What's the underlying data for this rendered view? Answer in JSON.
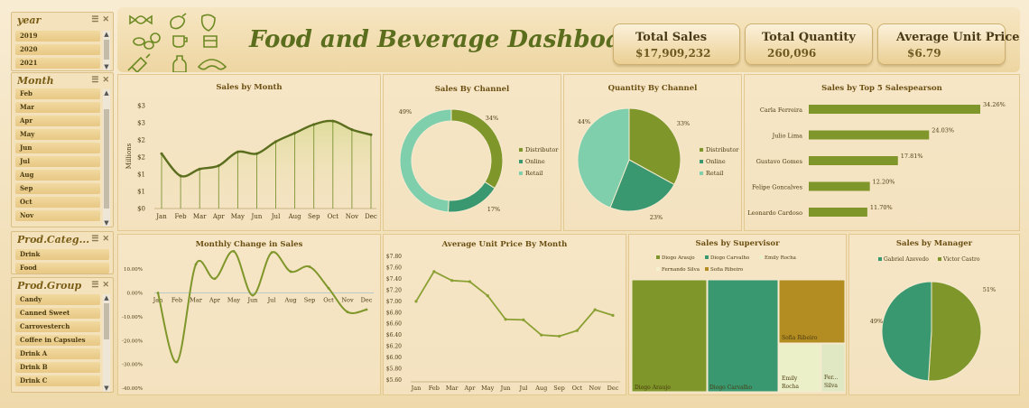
{
  "dashboard": {
    "title": "Food and Beverage Dashboard"
  },
  "kpis": {
    "total_sales": {
      "label": "Total Sales",
      "value": "$17,909,232"
    },
    "total_quantity": {
      "label": "Total Quantity",
      "value": "260,096"
    },
    "avg_unit_price": {
      "label": "Average Unit Price",
      "value": "$6.79"
    }
  },
  "slicers": {
    "year": {
      "label": "year",
      "items": [
        "2019",
        "2020",
        "2021"
      ]
    },
    "month": {
      "label": "Month",
      "items": [
        "Feb",
        "Mar",
        "Apr",
        "May",
        "Jun",
        "Jul",
        "Aug",
        "Sep",
        "Oct",
        "Nov"
      ]
    },
    "prod_category": {
      "label": "Prod.Categ...",
      "items": [
        "Drink",
        "Food"
      ]
    },
    "prod_group": {
      "label": "Prod.Group",
      "items": [
        "Candy",
        "Canned Sweet",
        "Carrovesterch",
        "Coffee in Capsules",
        "Drink A",
        "Drink B",
        "Drink C"
      ]
    }
  },
  "icons": [
    "wrapped-candy-icon",
    "eggplant-icon",
    "strawberry-icon",
    "coffee-beans-icon",
    "nut-icon",
    "coffee-cup-icon",
    "cake-icon",
    "candy-icon",
    "bottle-icon",
    "croissant-icon"
  ],
  "colors": {
    "olive": "#7f962a",
    "teal": "#3a9870",
    "mint": "#80cfac",
    "gold": "#b38d22",
    "cream": "#ecf0c8",
    "title": "#5b6e1e"
  },
  "chart_data": [
    {
      "type": "line",
      "title": "Sales by Month",
      "ylabel": "Millions",
      "categories": [
        "Jan",
        "Feb",
        "Mar",
        "Apr",
        "May",
        "Jun",
        "Jul",
        "Aug",
        "Sep",
        "Oct",
        "Nov",
        "Dec"
      ],
      "values": [
        1.6,
        0.95,
        1.15,
        1.25,
        1.65,
        1.6,
        1.95,
        2.2,
        2.45,
        2.55,
        2.3,
        2.15
      ],
      "yticks": [
        "$0",
        "$1",
        "$1",
        "$2",
        "$2",
        "$3",
        "$3"
      ],
      "ylim": [
        0,
        3
      ]
    },
    {
      "type": "pie",
      "title": "Sales By Channel",
      "series": [
        {
          "name": "Distributor",
          "value": 34,
          "label": "34%",
          "color": "#7f962a"
        },
        {
          "name": "Online",
          "value": 17,
          "label": "17%",
          "color": "#3a9870"
        },
        {
          "name": "Retail",
          "value": 49,
          "label": "49%",
          "color": "#80cfac"
        }
      ]
    },
    {
      "type": "pie",
      "title": "Quantity By Channel",
      "series": [
        {
          "name": "Distributor",
          "value": 33,
          "label": "33%",
          "color": "#7f962a"
        },
        {
          "name": "Online",
          "value": 23,
          "label": "23%",
          "color": "#3a9870"
        },
        {
          "name": "Retail",
          "value": 44,
          "label": "44%",
          "color": "#80cfac"
        }
      ]
    },
    {
      "type": "bar",
      "title": "Sales by Top 5 Salespearson",
      "categories": [
        "Carla Ferreira",
        "Julio Lima",
        "Gustavo Gomes",
        "Felipe Goncalves",
        "Leonardo Cardoso"
      ],
      "values": [
        34.26,
        24.03,
        17.81,
        12.2,
        11.7
      ],
      "labels": [
        "34.26%",
        "24.03%",
        "17.81%",
        "12.20%",
        "11.70%"
      ]
    },
    {
      "type": "line",
      "title": "Monthly Change in Sales",
      "categories": [
        "Jan",
        "Feb",
        "Mar",
        "Apr",
        "May",
        "Jun",
        "Jul",
        "Aug",
        "Sep",
        "Oct",
        "Nov",
        "Dec"
      ],
      "values": [
        0,
        -29,
        12,
        6,
        17.5,
        -1,
        17,
        9,
        11,
        2,
        -8,
        -7
      ],
      "yticks": [
        "10.00%",
        "0.00%",
        "-10.00%",
        "-20.00%",
        "-30.00%",
        "-40.00%"
      ],
      "ylim": [
        -40,
        15
      ]
    },
    {
      "type": "line",
      "title": "Average Unit Price By Month",
      "categories": [
        "Jan",
        "Feb",
        "Mar",
        "Apr",
        "May",
        "Jun",
        "Jul",
        "Aug",
        "Sep",
        "Oct",
        "Nov",
        "Dec"
      ],
      "values": [
        7.0,
        7.53,
        7.37,
        7.35,
        7.1,
        6.68,
        6.67,
        6.4,
        6.38,
        6.48,
        6.85,
        6.75
      ],
      "yticks": [
        "$7.80",
        "$7.60",
        "$7.40",
        "$7.20",
        "$7.00",
        "$6.80",
        "$6.60",
        "$6.40",
        "$6.20",
        "$6.00",
        "$5.80",
        "$5.60"
      ],
      "ylim": [
        5.5,
        7.9
      ]
    },
    {
      "type": "treemap",
      "title": "Sales by Supervisor",
      "series": [
        {
          "name": "Diogo Araujo",
          "color": "#7f962a"
        },
        {
          "name": "Diogo Carvalho",
          "color": "#3a9870"
        },
        {
          "name": "Sofia Ribeiro",
          "color": "#b38d22"
        },
        {
          "name": "Emily Rocha",
          "color": "#ecf0c8"
        },
        {
          "name": "Fer... Silva",
          "color": "#dfe8c2"
        }
      ],
      "legend": [
        "Diogo Araujo",
        "Diogo Carvalho",
        "Emily Rocha",
        "Fernando Silva",
        "Sofia Ribeiro"
      ]
    },
    {
      "type": "pie",
      "title": "Sales by Manager",
      "series": [
        {
          "name": "Gabriel Azevedo",
          "value": 49,
          "label": "49%",
          "color": "#3a9870"
        },
        {
          "name": "Victor Castro",
          "value": 51,
          "label": "51%",
          "color": "#7f962a"
        }
      ]
    }
  ]
}
